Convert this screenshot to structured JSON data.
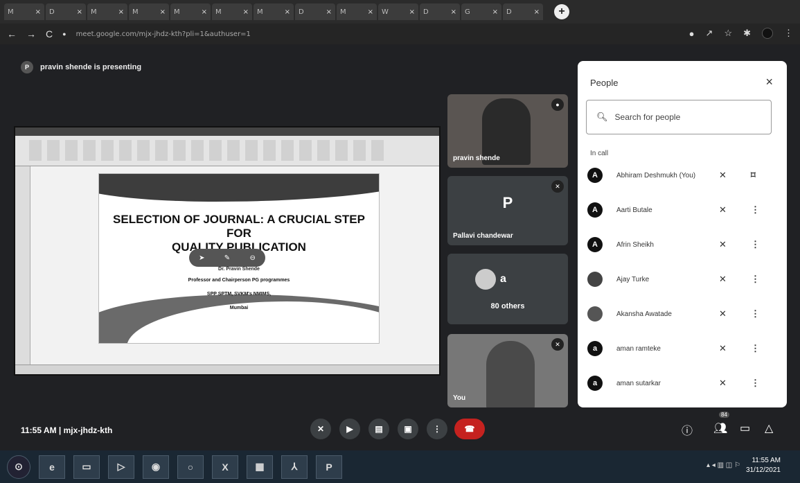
{
  "browser": {
    "tabs": [
      "M",
      "D",
      "M",
      "M",
      "M",
      "M",
      "M",
      "D",
      "M",
      "W",
      "D",
      "G",
      "D"
    ],
    "new_tab": "+",
    "url": "meet.google.com/mjx-jhdz-kth?pli=1&authuser=1",
    "nav": {
      "back": "←",
      "forward": "→",
      "reload": "C"
    }
  },
  "meet": {
    "presenting_text": "pravin shende is presenting",
    "presenting_icon": "P",
    "slide": {
      "title_line1": "SELECTION OF JOURNAL: A CRUCIAL STEP FOR",
      "title_line2": "QUALITY PUBLICATION",
      "presenter": "Dr. Pravin Shende",
      "line1": "Professor and Chairperson PG programmes",
      "line2": "SPP SPTM, SVKM's NMIMS,",
      "line3": "Mumbai"
    },
    "tiles": {
      "t1_name": "pravin shende",
      "t2_letter": "P",
      "t2_name": "Pallavi chandewar",
      "t3_letter": "a",
      "t3_others": "80 others",
      "t4_name": "You"
    }
  },
  "people": {
    "title": "People",
    "close": "×",
    "search_placeholder": "Search for people",
    "section": "In call",
    "rows": [
      {
        "initial": "A",
        "name": "Abhiram Deshmukh (You)"
      },
      {
        "initial": "A",
        "name": "Aarti Butale"
      },
      {
        "initial": "A",
        "name": "Afrin Sheikh"
      },
      {
        "initial": "",
        "name": "Ajay Turke"
      },
      {
        "initial": "",
        "name": "Akansha Awatade"
      },
      {
        "initial": "a",
        "name": "aman ramteke"
      },
      {
        "initial": "a",
        "name": "aman sutarkar"
      }
    ]
  },
  "controls": {
    "meeting_info": "11:55 AM | mjx-jhdz-kth",
    "participants_count": "84"
  },
  "taskbar": {
    "time": "11:55 AM",
    "date": "31/12/2021"
  }
}
